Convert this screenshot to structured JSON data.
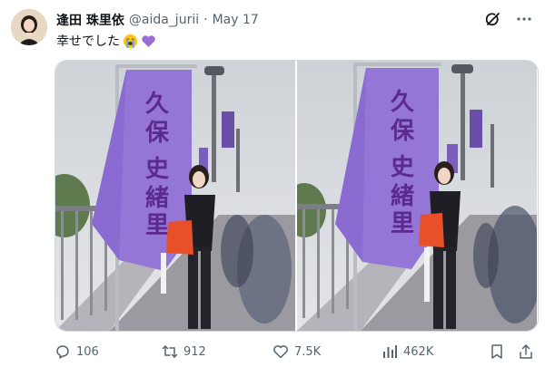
{
  "tweet": {
    "author_name": "逢田 珠里依",
    "handle": "@aida_jurii",
    "separator": "·",
    "date": "May 17",
    "text": "幸せでした",
    "emojis": [
      "loudly-crying-face-icon",
      "purple-heart-icon"
    ]
  },
  "media": {
    "photo_count": 2,
    "banner_text": [
      "久",
      "保",
      "史",
      "緒",
      "里"
    ]
  },
  "actions": {
    "replies": "106",
    "reposts": "912",
    "likes": "7.5K",
    "views": "462K"
  },
  "colors": {
    "text": "#0f1419",
    "secondary": "#536471",
    "banner_purple": "#8a6bd1",
    "banner_text": "#5b2a8c",
    "bag_orange": "#e8502a"
  }
}
